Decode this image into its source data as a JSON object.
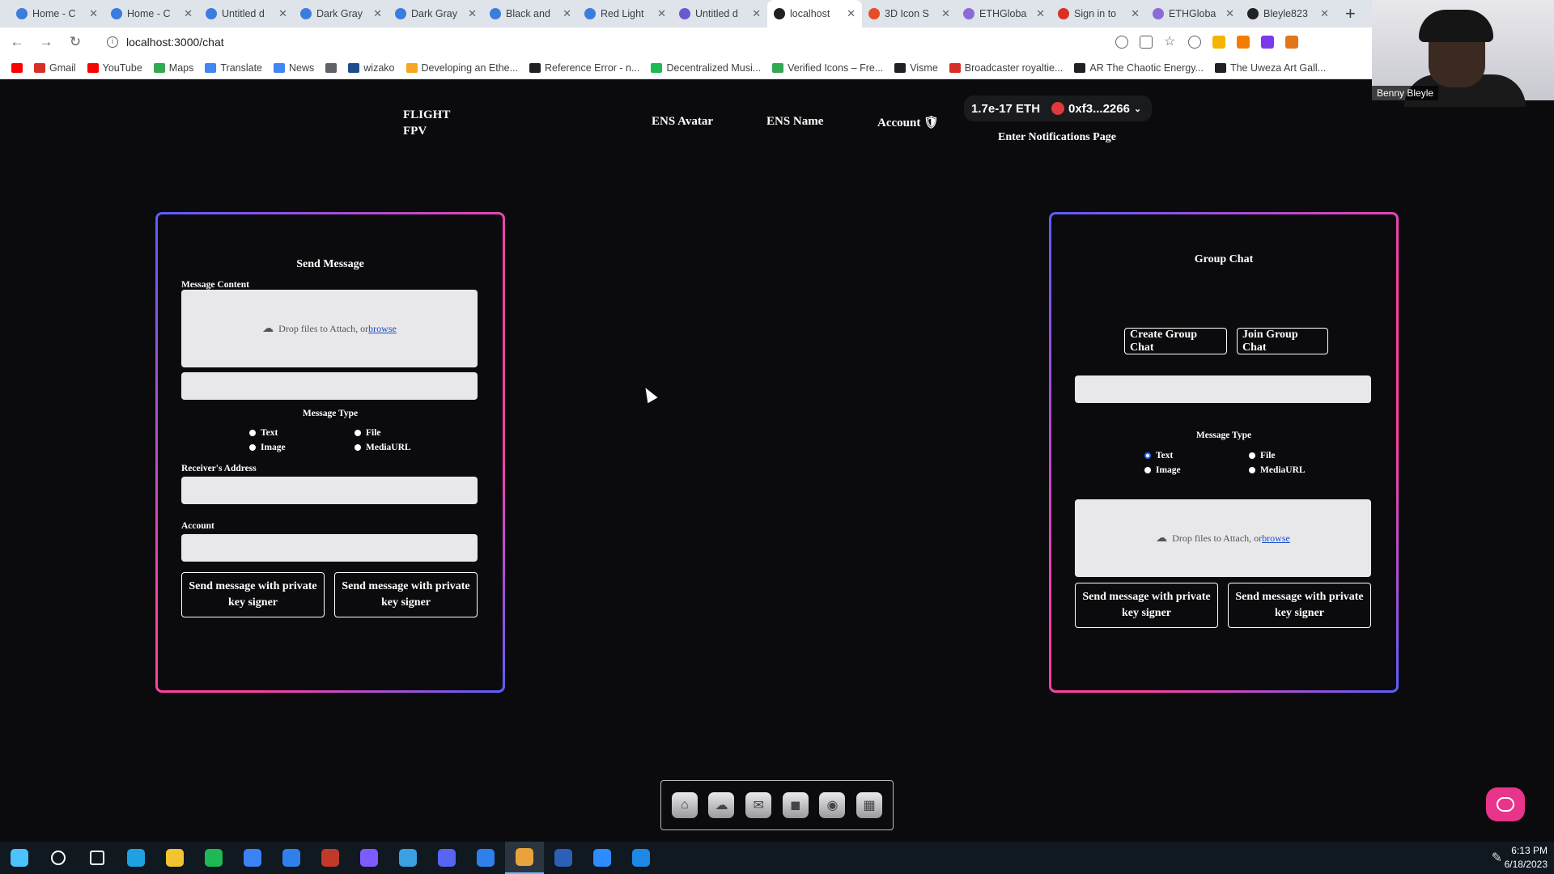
{
  "browser": {
    "tabs": [
      {
        "label": "Home - C",
        "color": "#3b7ddd"
      },
      {
        "label": "Home - C",
        "color": "#3b7ddd"
      },
      {
        "label": "Untitled d",
        "color": "#3b7ddd"
      },
      {
        "label": "Dark Gray",
        "color": "#3b7ddd"
      },
      {
        "label": "Dark Gray",
        "color": "#3b7ddd"
      },
      {
        "label": "Black and",
        "color": "#3b7ddd"
      },
      {
        "label": "Red Light",
        "color": "#3b7ddd"
      },
      {
        "label": "Untitled d",
        "color": "#6a5acd"
      },
      {
        "label": "localhost",
        "color": "#202124"
      },
      {
        "label": "3D Icon S",
        "color": "#e44d26"
      },
      {
        "label": "ETHGloba",
        "color": "#8a6cd8"
      },
      {
        "label": "Sign in to",
        "color": "#d93025"
      },
      {
        "label": "ETHGloba",
        "color": "#8a6cd8"
      },
      {
        "label": "Bleyle823",
        "color": "#202124"
      }
    ],
    "active_tab_index": 8,
    "url": "localhost:3000/chat",
    "bookmarks": [
      {
        "label": "",
        "color": "#ff0000"
      },
      {
        "label": "Gmail",
        "color": "#d93025"
      },
      {
        "label": "YouTube",
        "color": "#ff0000"
      },
      {
        "label": "Maps",
        "color": "#34a853"
      },
      {
        "label": "Translate",
        "color": "#4285f4"
      },
      {
        "label": "News",
        "color": "#4285f4"
      },
      {
        "label": "",
        "color": "#5f6368"
      },
      {
        "label": "wizako",
        "color": "#1e4d8c"
      },
      {
        "label": "Developing an Ethe...",
        "color": "#f5a623"
      },
      {
        "label": "Reference Error - n...",
        "color": "#202124"
      },
      {
        "label": "Decentralized Musi...",
        "color": "#1db954"
      },
      {
        "label": "Verified Icons – Fre...",
        "color": "#34a853"
      },
      {
        "label": "Visme",
        "color": "#202124"
      },
      {
        "label": "Broadcaster royaltie...",
        "color": "#d93025"
      },
      {
        "label": "AR The Chaotic Energy...",
        "color": "#202124"
      },
      {
        "label": "The Uweza Art Gall...",
        "color": "#202124"
      }
    ]
  },
  "header": {
    "brand_line1": "FLIGHT",
    "brand_line2": "FPV",
    "nav": [
      "ENS Avatar",
      "ENS Name",
      "Account 🛡"
    ],
    "wallet_balance": "1.7e-17 ETH",
    "wallet_address": "0xf3...2266",
    "notifications_link": "Enter Notifications Page"
  },
  "send_panel": {
    "title": "Send Message",
    "message_content_label": "Message Content",
    "drop_text": "Drop files to Attach, or",
    "browse_text": "browse",
    "message_type_label": "Message Type",
    "types": [
      "Text",
      "File",
      "Image",
      "MediaURL"
    ],
    "receiver_label": "Receiver's Address",
    "account_label": "Account",
    "button1": "Send message with private key signer",
    "button2": "Send message with private key signer"
  },
  "group_panel": {
    "title": "Group Chat",
    "create_button": "Create Group Chat",
    "join_button": "Join Group Chat",
    "message_type_label": "Message Type",
    "types": [
      "Text",
      "File",
      "Image",
      "MediaURL"
    ],
    "selected_type": "Text",
    "drop_text": "Drop files to Attach, or",
    "browse_text": "browse",
    "button1": "Send message with private key signer",
    "button2": "Send message with private key signer"
  },
  "webcam": {
    "name": "Benny Bleyle"
  },
  "taskbar": {
    "icons": [
      {
        "name": "windows-start-icon",
        "color": "#4cc2ff"
      },
      {
        "name": "search-icon",
        "color": "#ffffff"
      },
      {
        "name": "task-view-icon",
        "color": "#ffffff"
      },
      {
        "name": "edge-icon",
        "color": "#1fa0e0"
      },
      {
        "name": "file-explorer-icon",
        "color": "#f4c430"
      },
      {
        "name": "spotify-icon",
        "color": "#1db954"
      },
      {
        "name": "todo-icon",
        "color": "#3b82f6"
      },
      {
        "name": "vscode-icon",
        "color": "#2f80ed"
      },
      {
        "name": "app-red-icon",
        "color": "#c0392b"
      },
      {
        "name": "app-purple-icon",
        "color": "#7c5cff"
      },
      {
        "name": "app-folder-icon",
        "color": "#3aa0e0"
      },
      {
        "name": "discord-icon",
        "color": "#5865f2"
      },
      {
        "name": "vscode-alt-icon",
        "color": "#2f80ed"
      },
      {
        "name": "chrome-icon",
        "color": "#e8a33d"
      },
      {
        "name": "powershell-icon",
        "color": "#2b5fb8"
      },
      {
        "name": "zoom-icon",
        "color": "#2d8cff"
      },
      {
        "name": "app-blue-icon",
        "color": "#1e88e5"
      }
    ],
    "active_index": 13,
    "time": "6:13 PM",
    "date": "6/18/2023"
  }
}
